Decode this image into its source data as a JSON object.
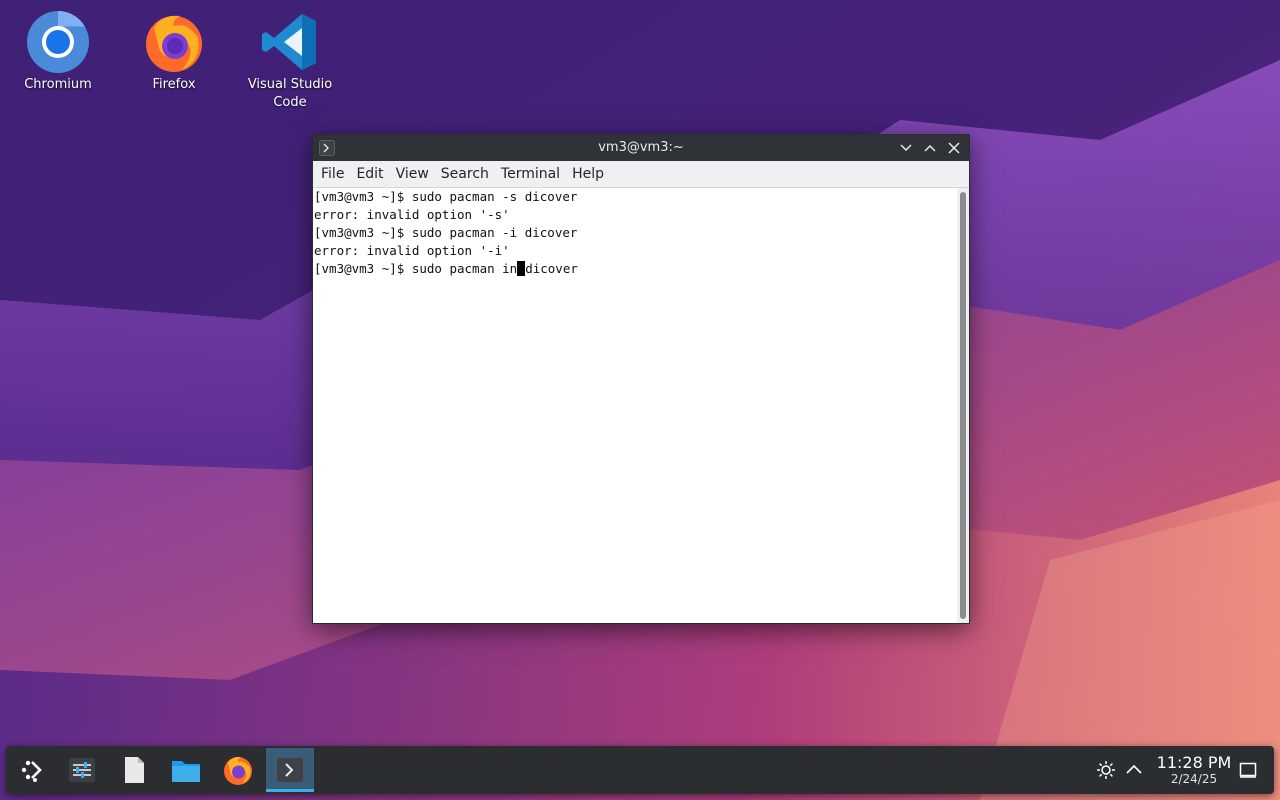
{
  "desktop": {
    "icons": [
      {
        "label": "Chromium",
        "icon": "chromium-icon"
      },
      {
        "label": "Firefox",
        "icon": "firefox-icon"
      },
      {
        "label_line1": "Visual Studio",
        "label_line2": "Code",
        "icon": "vscode-icon"
      }
    ]
  },
  "window": {
    "title": "vm3@vm3:~",
    "menu": [
      "File",
      "Edit",
      "View",
      "Search",
      "Terminal",
      "Help"
    ],
    "lines": [
      "[vm3@vm3 ~]$ sudo pacman -s dicover",
      "error: invalid option '-s'",
      "[vm3@vm3 ~]$ sudo pacman -i dicover",
      "error: invalid option '-i'"
    ],
    "current_line_before_cursor": "[vm3@vm3 ~]$ sudo pacman in",
    "current_line_after_cursor": "dicover"
  },
  "taskbar": {
    "items": [
      "app-launcher-icon",
      "system-settings-icon",
      "text-file-icon",
      "file-manager-icon",
      "firefox-icon",
      "terminal-icon"
    ],
    "active_item": "terminal-icon",
    "time": "11:28 PM",
    "date": "2/24/25"
  },
  "colors": {
    "titlebar": "#2f3236",
    "taskbar": "#2b2d31",
    "accent": "#3daee9"
  }
}
